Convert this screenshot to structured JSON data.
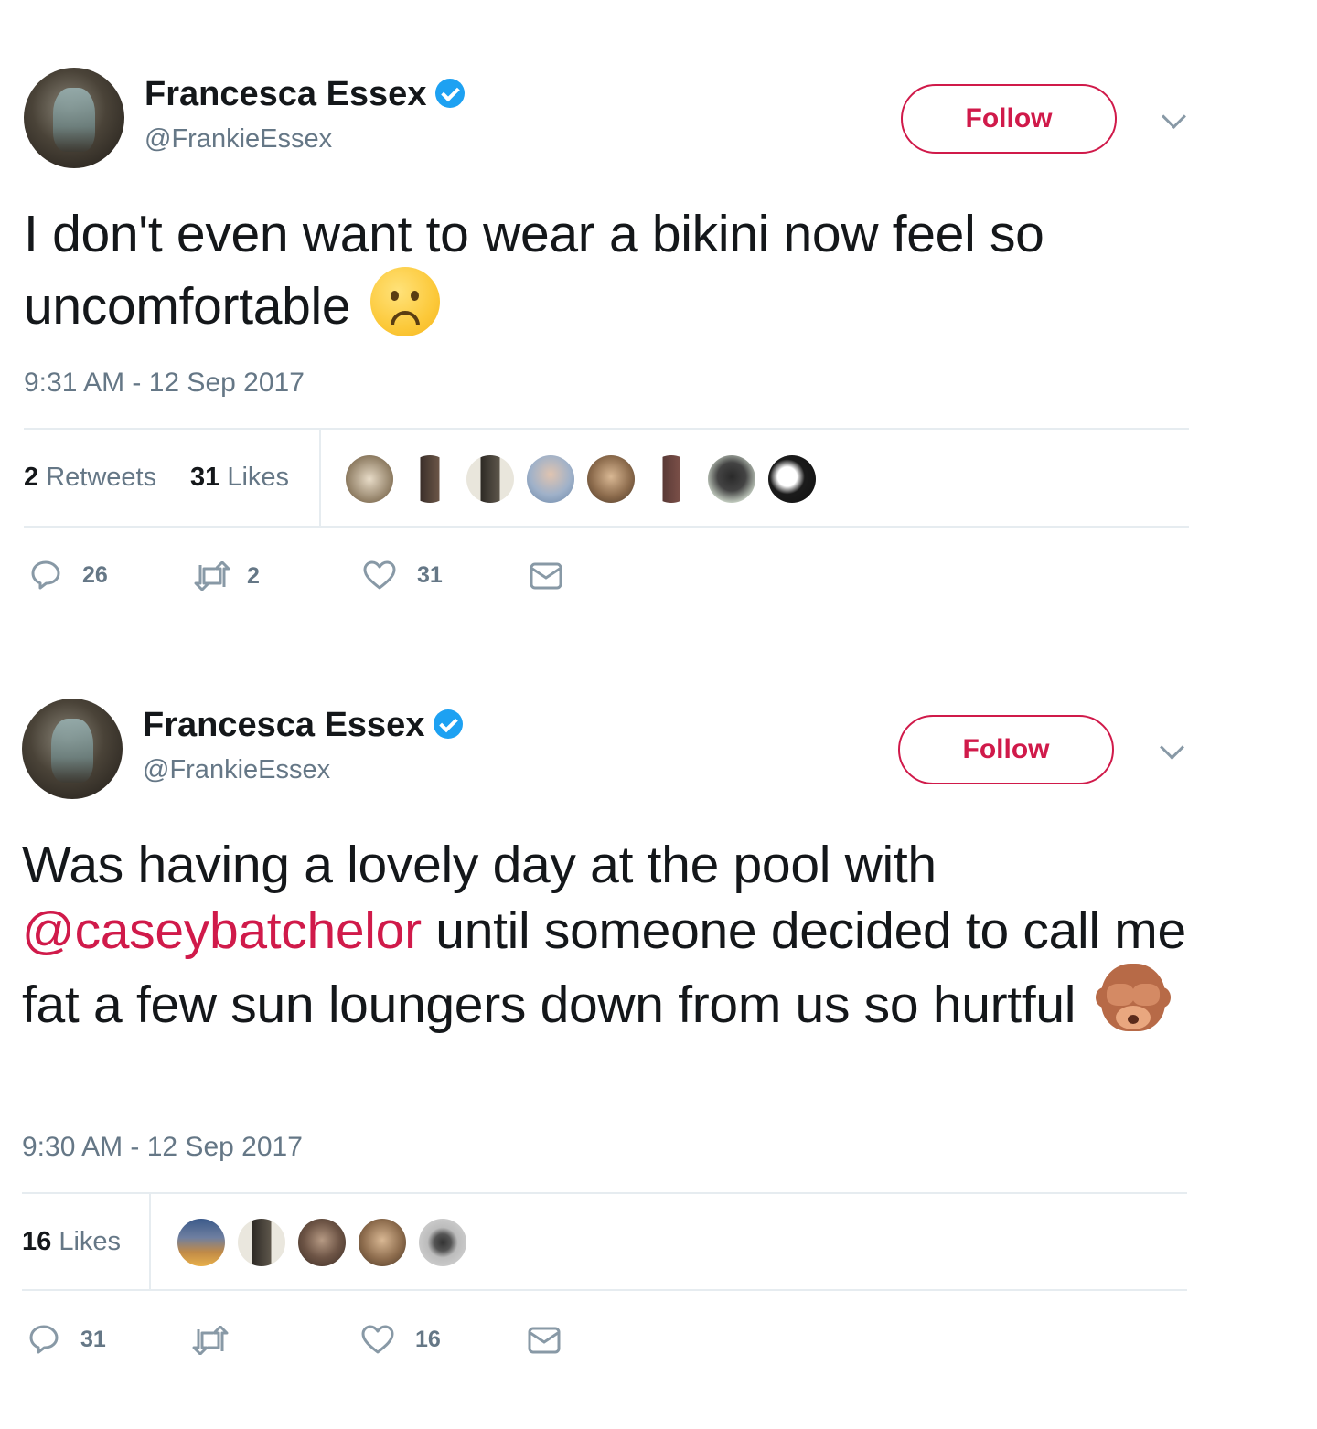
{
  "tweets": [
    {
      "name": "Francesca Essex",
      "handle": "@FrankieEssex",
      "follow_label": "Follow",
      "text_plain": "I don't even want to wear a bikini now feel so uncomfortable",
      "emoji": "frowning-face-emoji",
      "timestamp": "9:31 AM - 12 Sep 2017",
      "stats": {
        "retweets_count": "2",
        "retweets_label": "Retweets",
        "likes_count": "31",
        "likes_label": "Likes"
      },
      "liker_avatar_count": 8,
      "actions": {
        "replies": "26",
        "retweets": "2",
        "likes": "31"
      }
    },
    {
      "name": "Francesca Essex",
      "handle": "@FrankieEssex",
      "follow_label": "Follow",
      "text_before": "Was having a lovely day at the pool with",
      "mention": "@caseybatchelor",
      "text_after": "until someone decided to call me fat a few sun loungers down from us so hurtful",
      "emoji": "see-no-evil-monkey-emoji",
      "timestamp": "9:30 AM - 12 Sep 2017",
      "stats": {
        "likes_count": "16",
        "likes_label": "Likes"
      },
      "liker_avatar_count": 5,
      "actions": {
        "replies": "31",
        "retweets": "",
        "likes": "16"
      }
    }
  ],
  "colors": {
    "accent": "#d01a4a",
    "muted": "#657786",
    "verified": "#1da1f2",
    "divider": "#e6ecf0"
  }
}
